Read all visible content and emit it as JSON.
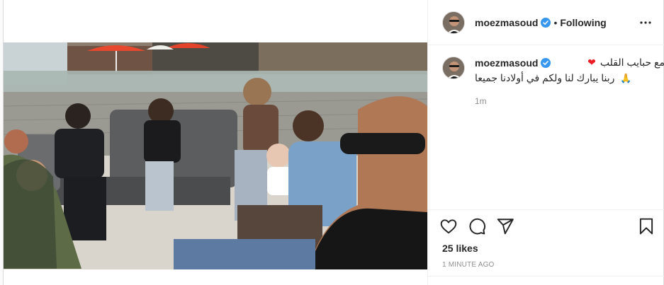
{
  "post": {
    "username": "moezmasoud",
    "verified": true,
    "separator": "•",
    "follow_status": "Following",
    "more_icon": "more-horizontal-icon",
    "caption": {
      "line1": "مع حبايب القلب",
      "heart_emoji": "❤",
      "line2": "ربنا يبارك لنا ولكم في أولادنا جميعا",
      "pray_emoji": "🙏"
    },
    "relative_time": "1m",
    "likes": "25 likes",
    "timestamp": "1 MINUTE AGO",
    "actions": [
      "heart-icon",
      "comment-icon",
      "share-icon",
      "bookmark-icon"
    ],
    "colors": {
      "verified_blue": "#3897f0",
      "text": "#262626",
      "muted": "#8e8e8e",
      "border": "#dbdbdb"
    }
  }
}
